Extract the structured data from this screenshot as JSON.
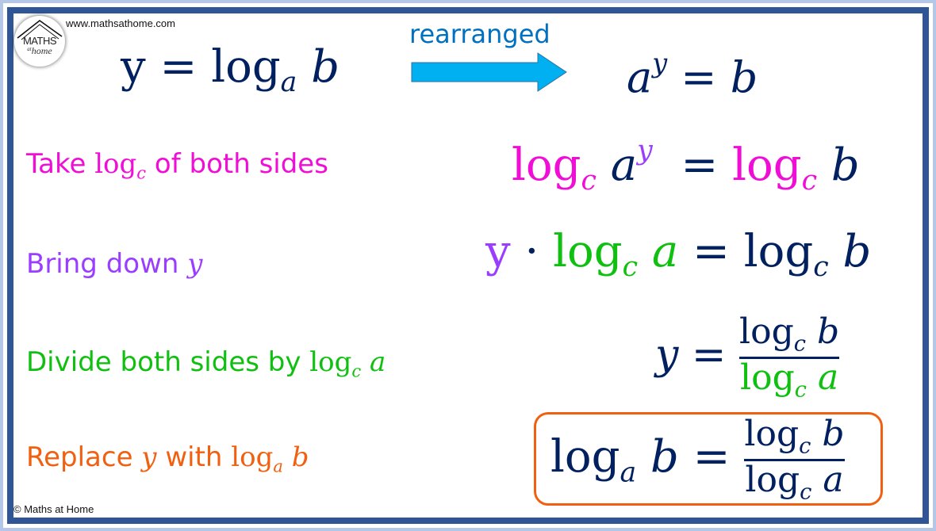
{
  "site_url": "www.mathsathome.com",
  "copyright": "© Maths at Home",
  "logo": {
    "line1": "MATHS",
    "line2": "home",
    "line2_prefix": "at"
  },
  "colors": {
    "navy": "#002060",
    "pink": "#f00ed6",
    "purple": "#9a3dff",
    "green": "#10c010",
    "orange": "#f06010",
    "arrow_blue": "#00b0f0",
    "frame_blue": "#2f5597",
    "outer_bg": "#b4c7e7"
  },
  "header": {
    "left_equation": {
      "lhs": "y",
      "eq": "=",
      "log": "log",
      "base": "a",
      "arg": "b"
    },
    "arrow_label": "rearranged",
    "arrow_icon": "right-arrow-icon",
    "right_equation": {
      "base": "a",
      "exp": "y",
      "eq": "=",
      "rhs": "b"
    }
  },
  "steps": [
    {
      "label_text": "Take ",
      "label_log": "log",
      "label_sub": "c",
      "label_tail": " of both sides",
      "equation": {
        "log": "log",
        "sub": "c",
        "a": "a",
        "exp": "y",
        "eq": "=",
        "rlog": "log",
        "rsub": "c",
        "rarg": "b"
      }
    },
    {
      "label_text": "Bring down ",
      "label_var": "y",
      "equation": {
        "y": "y",
        "dot": "·",
        "log": "log",
        "sub": "c",
        "a": "a",
        "eq": "=",
        "rlog": "log",
        "rsub": "c",
        "rarg": "b"
      }
    },
    {
      "label_text": "Divide both sides by ",
      "label_log": "log",
      "label_sub": "c",
      "label_var": "a",
      "equation": {
        "y": "y",
        "eq": "=",
        "num_log": "log",
        "num_sub": "c",
        "num_arg": "b",
        "den_log": "log",
        "den_sub": "c",
        "den_arg": "a"
      }
    },
    {
      "label_text": "Replace ",
      "label_var": "y",
      "label_mid": " with ",
      "label_log": "log",
      "label_sub": "a",
      "label_arg": "b",
      "equation": {
        "log": "log",
        "sub": "a",
        "arg": "b",
        "eq": "=",
        "num_log": "log",
        "num_sub": "c",
        "num_arg": "b",
        "den_log": "log",
        "den_sub": "c",
        "den_arg": "a"
      }
    }
  ]
}
